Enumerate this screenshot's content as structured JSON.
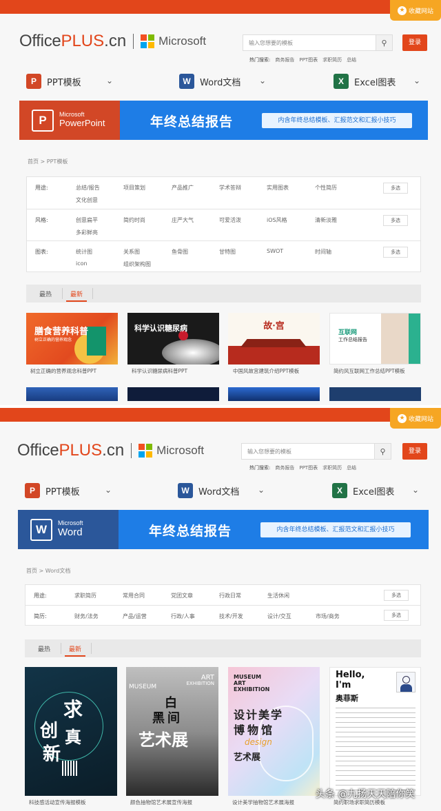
{
  "header": {
    "favorite_label": "收藏网站",
    "logo_office": "Office",
    "logo_plus": "PLUS",
    "logo_cn": ".cn",
    "microsoft": "Microsoft",
    "search_placeholder": "输入您想要的模板",
    "hot_label": "热门搜索:",
    "hot_items": [
      "商务报告",
      "PPT图表",
      "求职简历",
      "总结"
    ],
    "login_label": "登录"
  },
  "nav": {
    "ppt": "PPT模板",
    "word": "Word文档",
    "excel": "Excel图表"
  },
  "banner": {
    "title": "年终总结报告",
    "pill": "内含年终总结模板、汇报范文和汇报小技巧",
    "ppt_brand_small": "Microsoft",
    "ppt_brand": "PowerPoint",
    "word_brand_small": "Microsoft",
    "word_brand": "Word"
  },
  "ppt_page": {
    "breadcrumb": "首页 > PPT模板",
    "filters": [
      {
        "label": "用途:",
        "options": [
          "总结/报告",
          "项目策划",
          "产品推广",
          "学术答辩",
          "实用图表",
          "个性简历",
          "文化创意"
        ]
      },
      {
        "label": "风格:",
        "options": [
          "创意扁平",
          "简约时尚",
          "庄严大气",
          "可爱活泼",
          "iOS风格",
          "清新淡雅",
          "多彩鲜亮"
        ]
      },
      {
        "label": "图表:",
        "options": [
          "统计图",
          "关系图",
          "鱼骨图",
          "甘特图",
          "SWOT",
          "时间轴",
          "icon",
          "组织架构图"
        ]
      }
    ],
    "more_label": "多选",
    "tabs": [
      "最热",
      "最新"
    ],
    "cards": [
      {
        "caption": "树立正确的营养观念科普PPT",
        "headline": "膳食营养科普",
        "sub": "树立正确的营养观念"
      },
      {
        "caption": "科学认识糖尿病科普PPT",
        "headline": "科学认识糖尿病"
      },
      {
        "caption": "中国风故宫建筑介绍PPT模板",
        "headline": "故·宫"
      },
      {
        "caption": "简约风互联网工作总结PPT模板",
        "headline": "互联网",
        "sub": "工作总结报告"
      }
    ]
  },
  "word_page": {
    "breadcrumb": "首页 > Word文档",
    "filters": [
      {
        "label": "用途:",
        "options": [
          "求职简历",
          "常用合同",
          "党团文章",
          "行政日常",
          "生活休闲"
        ]
      },
      {
        "label": "简历:",
        "options": [
          "财务/法务",
          "产品/运营",
          "行政/人事",
          "技术/开发",
          "设计/交互",
          "市场/商务"
        ]
      }
    ],
    "more_label": "多选",
    "tabs": [
      "最热",
      "最新"
    ],
    "cards": [
      {
        "caption": "科技感活动宣传海报模板",
        "c1": "求",
        "c2": "创",
        "c3": "真",
        "c4": "新"
      },
      {
        "caption": "颜色抽物馆艺术展宣传海报",
        "l1": "ART",
        "l2": "EXHIBITION",
        "l3": "MUSEUM",
        "c1": "白",
        "c2": "黑",
        "c3": "间",
        "c4": "艺术展"
      },
      {
        "caption": "设计美学抽物馆艺术展海报",
        "l1": "MUSEUM",
        "l2": "ART",
        "l3": "EXHIBITION",
        "t1": "设计美学",
        "t2": "博物馆",
        "t3": "design",
        "t4": "艺术展"
      },
      {
        "caption": "简约职场求职简历模板",
        "hello": "Hello,",
        "im": "I'm",
        "name": "奥菲斯"
      }
    ]
  },
  "watermark": "头条 @九扬天天陪你笑",
  "colors": {
    "brand": "#e2461b",
    "banner_blue": "#1e7de6",
    "ppt": "#d24726",
    "word": "#2b579a",
    "excel": "#217346"
  }
}
